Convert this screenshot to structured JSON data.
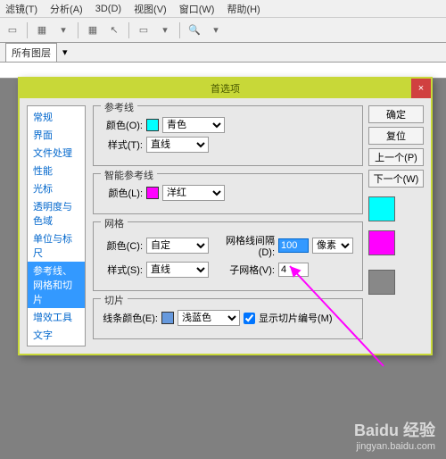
{
  "menu": [
    "滤镜(T)",
    "分析(A)",
    "3D(D)",
    "视图(V)",
    "窗口(W)",
    "帮助(H)"
  ],
  "optionbar": {
    "label": "所有图层"
  },
  "dialog": {
    "title": "首选项",
    "close": "×",
    "sidebar": [
      "常规",
      "界面",
      "文件处理",
      "性能",
      "光标",
      "透明度与色域",
      "单位与标尺",
      "参考线、网格和切片",
      "增效工具",
      "文字"
    ],
    "activeIndex": 7,
    "buttons": {
      "ok": "确定",
      "reset": "复位",
      "prev": "上一个(P)",
      "next": "下一个(W)"
    },
    "g1": {
      "title": "参考线",
      "colorLbl": "颜色(O):",
      "colorVal": "青色",
      "styleLbl": "样式(T):",
      "styleVal": "直线"
    },
    "g2": {
      "title": "智能参考线",
      "colorLbl": "颜色(L):",
      "colorVal": "洋红"
    },
    "g3": {
      "title": "网格",
      "colorLbl": "颜色(C):",
      "colorVal": "自定",
      "styleLbl": "样式(S):",
      "styleVal": "直线",
      "gapLbl": "网格线间隔(D):",
      "gapVal": "100",
      "gapUnit": "像素",
      "subLbl": "子网格(V):",
      "subVal": "4"
    },
    "g4": {
      "title": "切片",
      "colorLbl": "线条颜色(E):",
      "colorVal": "浅蓝色",
      "chkLbl": "显示切片编号(M)"
    }
  },
  "watermark": {
    "brand": "Baidu 经验",
    "url": "jingyan.baidu.com"
  }
}
